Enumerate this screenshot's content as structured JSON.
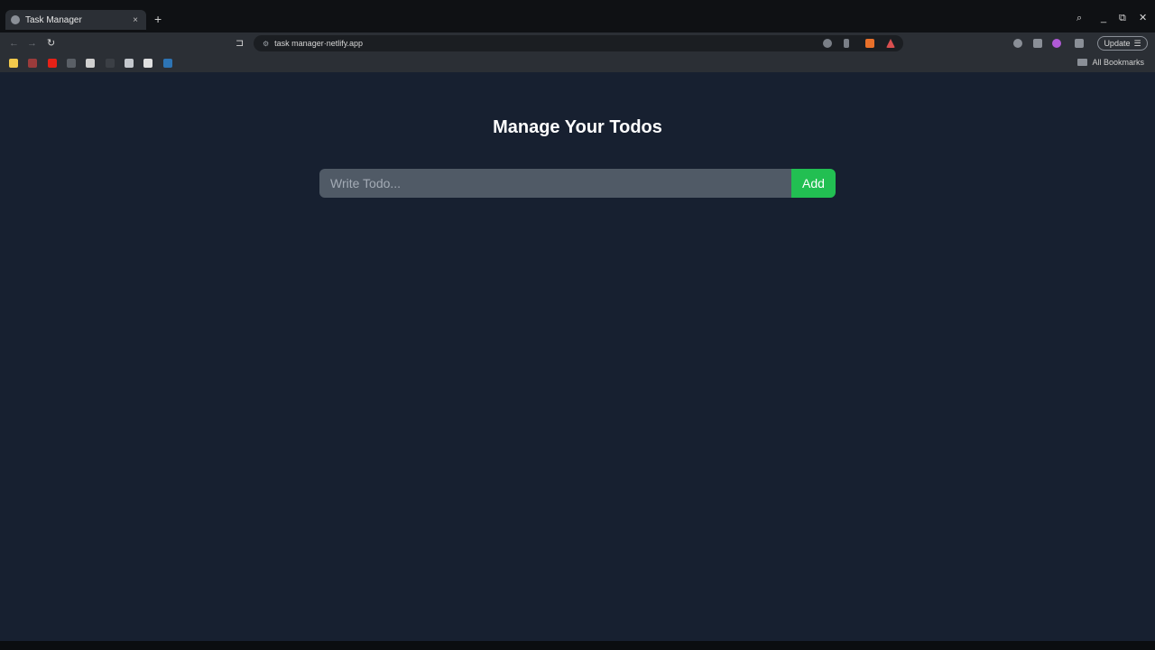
{
  "browser": {
    "tab": {
      "title": "Task Manager",
      "favicon": "globe-icon",
      "close": "×"
    },
    "new_tab": "+",
    "window_controls": {
      "search": "⌕",
      "minimize": "_",
      "restore": "⧉",
      "close": "✕"
    },
    "nav": {
      "back": "←",
      "forward": "→",
      "reload": "↻",
      "bookmark": "⊐"
    },
    "url": "task manager·netlify.app",
    "url_icons": [
      "translate-icon",
      "share-icon",
      "brave-shield-icon",
      "brave-rewards-icon"
    ],
    "extensions": [
      "sync-icon",
      "sidebar-icon",
      "extension-icon",
      "wallet-icon"
    ],
    "update_label": "Update",
    "update_menu_icon": "☰",
    "bookmarks": [
      {
        "icon": "maps-bookmark-icon",
        "color": "#f2c94c"
      },
      {
        "icon": "gmail-bookmark-icon",
        "color": "#9a3b3b"
      },
      {
        "icon": "youtube-bookmark-icon",
        "color": "#e62117"
      },
      {
        "icon": "site-bookmark-icon",
        "color": "#5a5f66"
      },
      {
        "icon": "github-bookmark-icon",
        "color": "#d0d0d0"
      },
      {
        "icon": "site-bookmark-icon",
        "color": "#3b3f45"
      },
      {
        "icon": "site-bookmark-icon",
        "color": "#c4c8cd"
      },
      {
        "icon": "x-bookmark-icon",
        "color": "#e0e0e0"
      },
      {
        "icon": "linkedin-bookmark-icon",
        "color": "#2d74b4"
      }
    ],
    "all_bookmarks": "All Bookmarks"
  },
  "page": {
    "title": "Manage Your Todos",
    "input_placeholder": "Write Todo...",
    "add_label": "Add"
  },
  "colors": {
    "page_bg": "#172030",
    "input_bg": "#505a66",
    "add_button": "#22bf52"
  }
}
